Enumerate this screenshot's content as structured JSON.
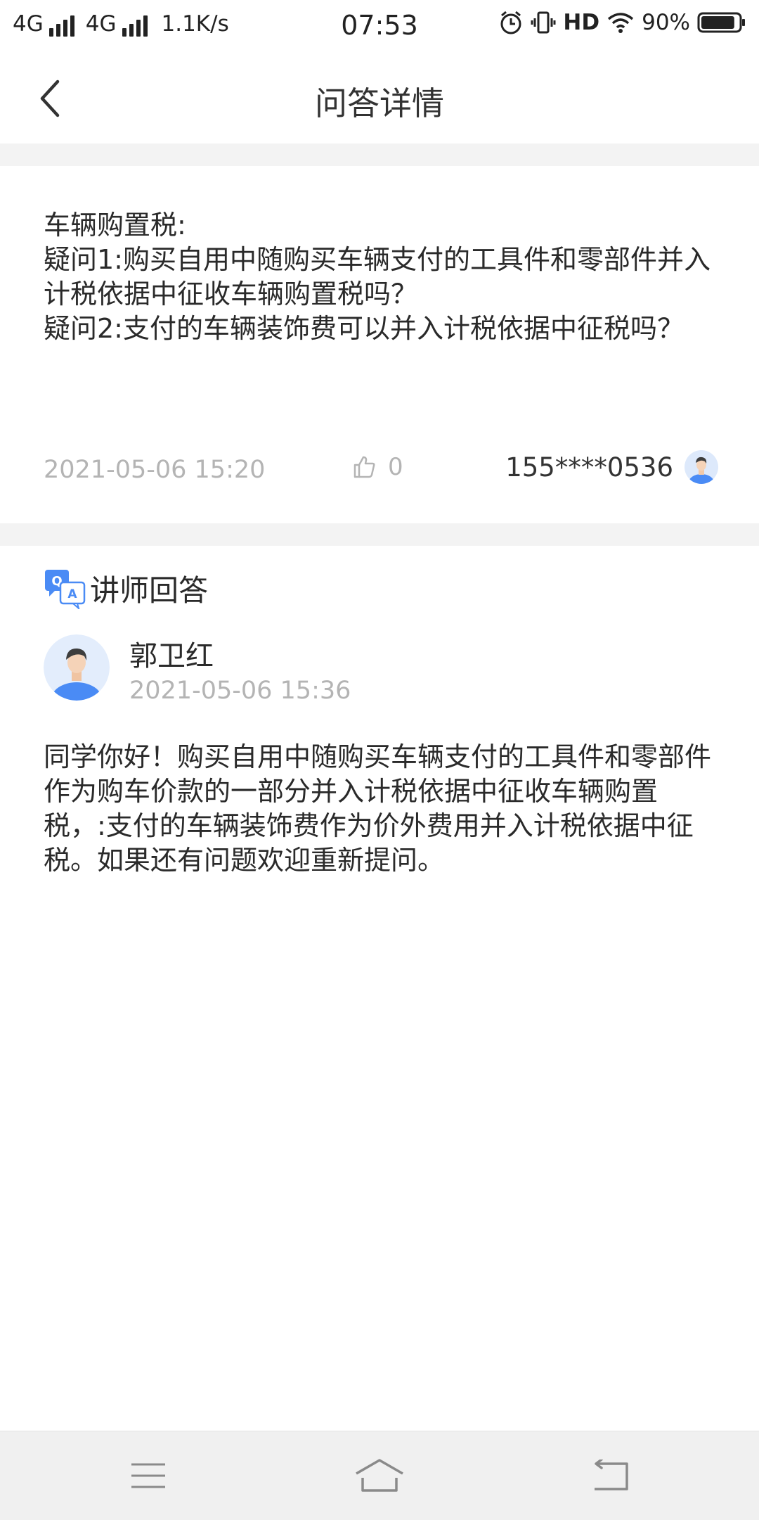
{
  "status_bar": {
    "network1": "4G",
    "network2": "4G",
    "speed": "1.1K/s",
    "time": "07:53",
    "hd": "HD",
    "battery": "90%",
    "battery_level": 0.9,
    "icons": [
      "signal-icon",
      "alarm-icon",
      "vibrate-icon",
      "wifi-icon",
      "battery-icon"
    ]
  },
  "header": {
    "title": "问答详情",
    "back_icon": "chevron-left-icon"
  },
  "question": {
    "text": "车辆购置税:\n疑问1:购买自用中随购买车辆支付的工具件和零部件并入计税依据中征收车辆购置税吗？\n疑问2:支付的车辆装饰费可以并入计税依据中征税吗？",
    "date": "2021-05-06 15:20",
    "likes": "0",
    "user_phone": "155****0536"
  },
  "answer": {
    "section_label": "讲师回答",
    "teacher_name": "郭卫红",
    "time": "2021-05-06 15:36",
    "text": "同学你好！购买自用中随购买车辆支付的工具件和零部件作为购车价款的一部分并入计税依据中征收车辆购置税，:支付的车辆装饰费作为价外费用并入计税依据中征税。如果还有问题欢迎重新提问。"
  },
  "colors": {
    "accent_blue": "#4a8bf5",
    "muted_gray": "#b4b4b4",
    "divider_gray": "#f3f3f3"
  },
  "bottom_nav": {
    "icons": [
      "menu-icon",
      "home-icon",
      "back-icon"
    ]
  }
}
